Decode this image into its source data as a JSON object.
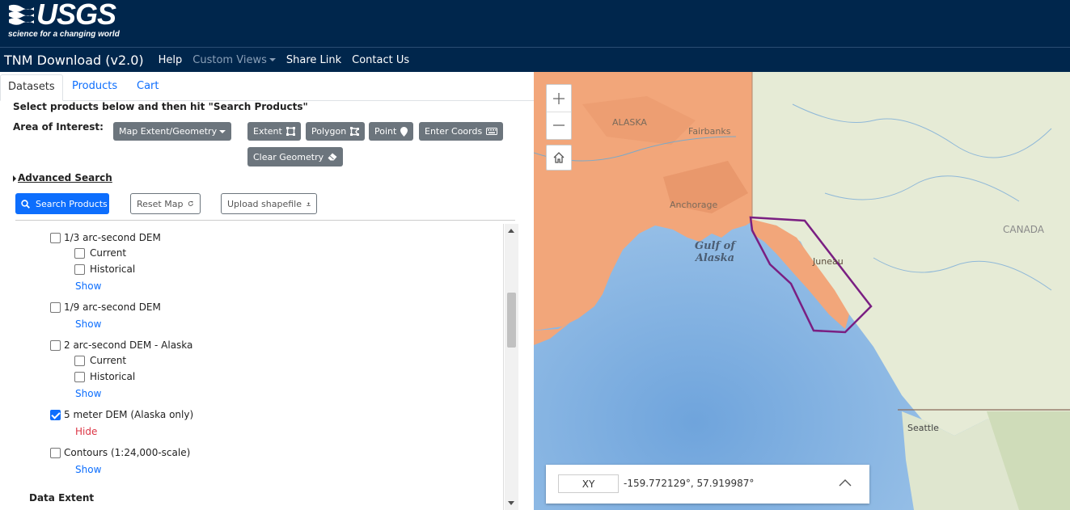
{
  "header": {
    "logo_text": "USGS",
    "logo_tagline": "science for a changing world"
  },
  "navbar": {
    "brand": "TNM Download (v2.0)",
    "links": [
      "Help",
      "Custom Views",
      "Share Link",
      "Contact Us"
    ]
  },
  "tabs": [
    "Datasets",
    "Products",
    "Cart"
  ],
  "panel": {
    "instruction": "Select products below and then hit \"Search Products\"",
    "aoi_label": "Area of Interest:",
    "aoi_dropdown": "Map Extent/Geometry",
    "aoi_buttons": [
      "Extent",
      "Polygon",
      "Point",
      "Enter Coords",
      "Clear Geometry"
    ],
    "advanced_search": "Advanced Search",
    "search_button": "Search Products",
    "reset_button": "Reset Map",
    "upload_button": "Upload shapefile"
  },
  "datasets": [
    {
      "label": "1/3 arc-second DEM",
      "checked": false,
      "subs": [
        "Current",
        "Historical"
      ],
      "toggle": "Show"
    },
    {
      "label": "1/9 arc-second DEM",
      "checked": false,
      "subs": [],
      "toggle": "Show"
    },
    {
      "label": "2 arc-second DEM - Alaska",
      "checked": false,
      "subs": [
        "Current",
        "Historical"
      ],
      "toggle": "Show"
    },
    {
      "label": "5 meter DEM (Alaska only)",
      "checked": true,
      "subs": [],
      "toggle": "Hide"
    },
    {
      "label": "Contours (1:24,000-scale)",
      "checked": false,
      "subs": [],
      "toggle": "Show"
    }
  ],
  "section_heading": "Data Extent",
  "map": {
    "labels": [
      "ALASKA",
      "Fairbanks",
      "Anchorage",
      "Gulf of",
      "Alaska",
      "Juneau",
      "CANADA",
      "Seattle"
    ],
    "coord_mode": "XY",
    "coordinates": "-159.772129°, 57.919987°",
    "colors": {
      "coverage": "#f2a67a",
      "aoi_polygon": "#7a1f82",
      "ocean": "#9cc5e8",
      "land": "#e8ecd8"
    }
  }
}
